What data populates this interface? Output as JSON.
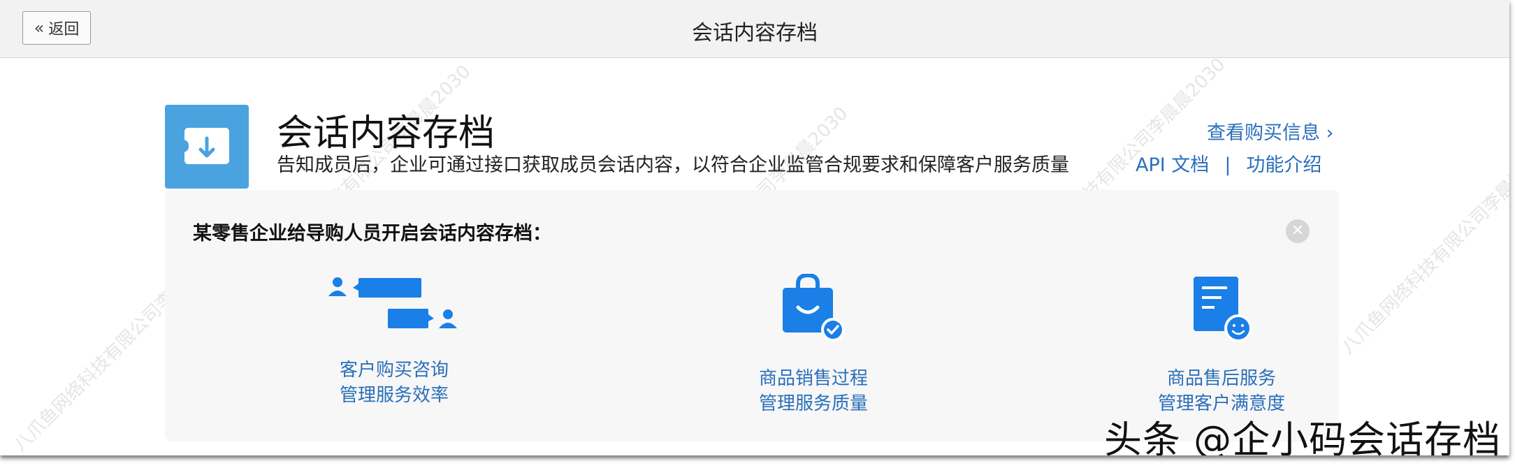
{
  "topbar": {
    "back_label": "返回",
    "title": "会话内容存档"
  },
  "header": {
    "title": "会话内容存档",
    "description": "告知成员后，企业可通过接口获取成员会话内容，以符合企业监管合规要求和保障客户服务质量",
    "buy_link": "查看购买信息 ›",
    "api_doc_link": "API 文档",
    "separator": "|",
    "intro_link": "功能介绍"
  },
  "panel": {
    "heading": "某零售企业给导购人员开启会话内容存档：",
    "close_icon": "✕",
    "features": [
      {
        "icon": "chat-users-icon",
        "line1": "客户购买咨询",
        "line2": "管理服务效率"
      },
      {
        "icon": "shopping-bag-check-icon",
        "line1": "商品销售过程",
        "line2": "管理服务质量"
      },
      {
        "icon": "document-smile-icon",
        "line1": "商品售后服务",
        "line2": "管理客户满意度"
      }
    ]
  },
  "watermarks": {
    "diagonal_text": "八爪鱼网络科技有限公司李晨晨2030",
    "brand": "头条 @企小码会话存档"
  },
  "colors": {
    "accent": "#1a7fe6",
    "link": "#2a6fba",
    "icon_bg": "#4aa3df",
    "topbar_bg": "#f2f2f2",
    "panel_bg": "#f7f7f7"
  }
}
